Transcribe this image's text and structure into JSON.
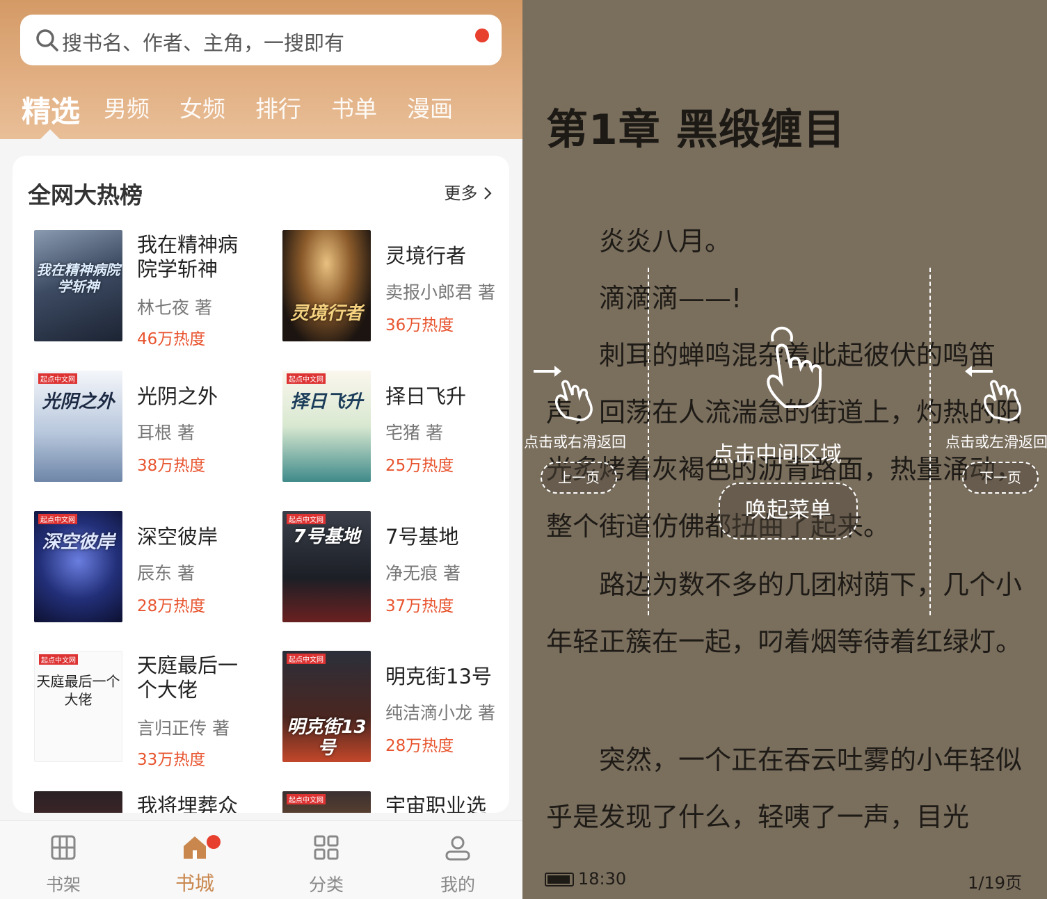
{
  "left": {
    "search": {
      "placeholder": "搜书名、作者、主角，一搜即有"
    },
    "tabs": [
      "精选",
      "男频",
      "女频",
      "排行",
      "书单",
      "漫画"
    ],
    "section": {
      "title": "全网大热榜",
      "more": "更多"
    },
    "books": [
      {
        "title": "我在精神病院学斩神",
        "author": "林七夜 著",
        "heat": "46万热度",
        "cover_text": "我在精神病院学斩神"
      },
      {
        "title": "灵境行者",
        "author": "卖报小郎君 著",
        "heat": "36万热度",
        "cover_text": "灵境行者"
      },
      {
        "title": "光阴之外",
        "author": "耳根  著",
        "heat": "38万热度",
        "cover_text": "光阴之外"
      },
      {
        "title": "择日飞升",
        "author": "宅猪 著",
        "heat": "25万热度",
        "cover_text": "择日飞升"
      },
      {
        "title": "深空彼岸",
        "author": "辰东 著",
        "heat": "28万热度",
        "cover_text": "深空彼岸"
      },
      {
        "title": "7号基地",
        "author": "净无痕 著",
        "heat": "37万热度",
        "cover_text": "7号基地"
      },
      {
        "title": "天庭最后一个大佬",
        "author": "言归正传 著",
        "heat": "33万热度",
        "cover_text": "天庭最后一个大佬"
      },
      {
        "title": "明克街13号",
        "author": "纯洁滴小龙 著",
        "heat": "28万热度",
        "cover_text": "明克街13号"
      },
      {
        "title": "我将埋葬众",
        "author": "",
        "heat": "",
        "cover_text": ""
      },
      {
        "title": "宇宙职业选",
        "author": "",
        "heat": "",
        "cover_text": ""
      }
    ],
    "cover_brand": "起点中文网",
    "nav": [
      {
        "label": "书架",
        "icon": "bookshelf-icon"
      },
      {
        "label": "书城",
        "icon": "home-icon"
      },
      {
        "label": "分类",
        "icon": "grid-icon"
      },
      {
        "label": "我的",
        "icon": "user-icon"
      }
    ]
  },
  "right": {
    "chapter_title": "第1章 黑缎缠目",
    "paragraphs": [
      "　　炎炎八月。",
      "　　滴滴滴——!",
      "　　刺耳的蝉鸣混杂着此起彼伏的鸣笛声，回荡在人流湍急的街道上，灼热的阳光炙烤着灰褐色的沥青路面，热量涌动，整个街道仿佛都扭曲了起来。",
      "　　路边为数不多的几团树荫下，几个小年轻正簇在一起，叼着烟等待着红绿灯。",
      "　　突然，一个正在吞云吐雾的小年轻似乎是发现了什么，轻咦了一声，目光"
    ],
    "overlay": {
      "left_hint": "点击或右滑返回",
      "left_btn": "上一页",
      "center_hint": "点击中间区域",
      "center_btn": "唤起菜单",
      "right_hint": "点击或左滑返回",
      "right_btn": "下一页"
    },
    "status": {
      "time": "18:30",
      "page": "1/19页"
    }
  },
  "colors": {
    "accent": "#c9874e",
    "heat": "#e8542f",
    "reader_bg": "#7a6e5d",
    "badge": "#e8402f"
  }
}
